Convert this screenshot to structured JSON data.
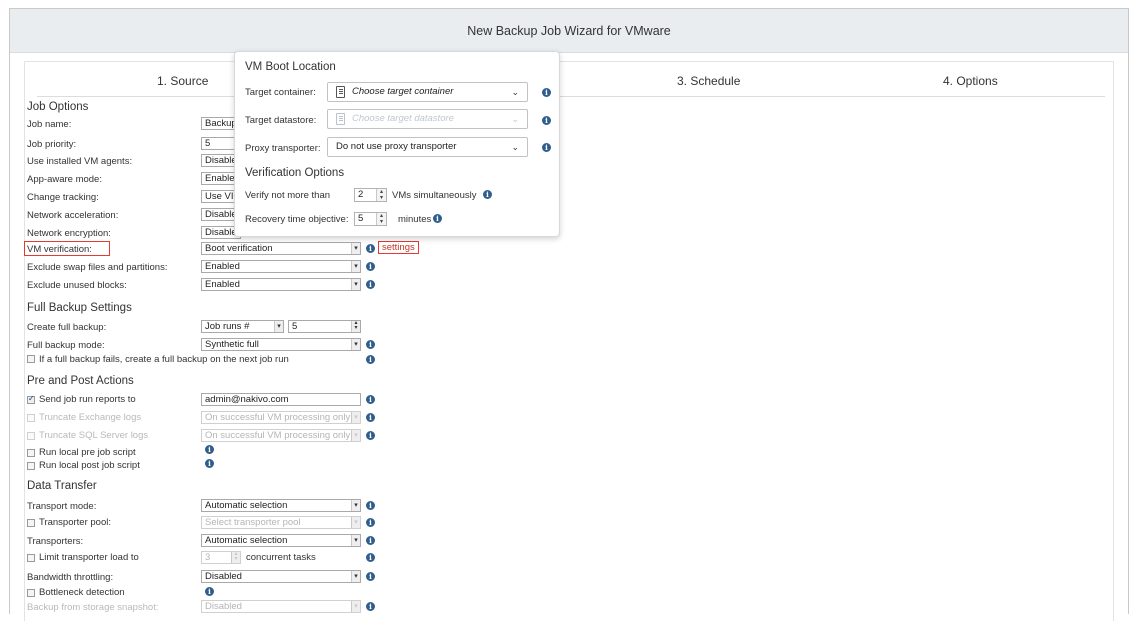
{
  "window": {
    "title": "New Backup Job Wizard for VMware"
  },
  "steps": [
    "1. Source",
    "3. Schedule",
    "4. Options"
  ],
  "sections": {
    "job_options": "Job Options",
    "full_backup": "Full Backup Settings",
    "pre_post": "Pre and Post Actions",
    "data_transfer": "Data Transfer"
  },
  "job_options": {
    "job_name": {
      "label": "Job name:",
      "value": "Backup"
    },
    "job_priority": {
      "label": "Job priority:",
      "value": "5"
    },
    "vm_agents": {
      "label": "Use installed VM agents:",
      "value": "Disable"
    },
    "app_aware": {
      "label": "App-aware mode:",
      "value": "Enable"
    },
    "change_tracking": {
      "label": "Change tracking:",
      "value": "Use VI"
    },
    "net_accel": {
      "label": "Network acceleration:",
      "value": "Disable"
    },
    "net_encrypt": {
      "label": "Network encryption:",
      "value": "Disable"
    },
    "vm_verification": {
      "label": "VM verification:",
      "value": "Boot verification",
      "settings_link": "settings"
    },
    "exclude_swap": {
      "label": "Exclude swap files and partitions:",
      "value": "Enabled"
    },
    "exclude_unused": {
      "label": "Exclude unused blocks:",
      "value": "Enabled"
    }
  },
  "full_backup": {
    "create": {
      "label": "Create full backup:",
      "value": "Job runs #",
      "number": "5"
    },
    "mode": {
      "label": "Full backup mode:",
      "value": "Synthetic full"
    },
    "fail_checkbox": {
      "label": "If a full backup fails, create a full backup on the next job run",
      "checked": false
    }
  },
  "pre_post": {
    "send_reports": {
      "label": "Send job run reports to",
      "checked": true,
      "value": "admin@nakivo.com"
    },
    "truncate_exchange": {
      "label": "Truncate Exchange logs",
      "checked": false,
      "value": "On successful VM processing only"
    },
    "truncate_sql": {
      "label": "Truncate SQL Server logs",
      "checked": false,
      "value": "On successful VM processing only"
    },
    "pre_script": {
      "label": "Run local pre job script",
      "checked": false
    },
    "post_script": {
      "label": "Run local post job script",
      "checked": false
    }
  },
  "data_transfer": {
    "transport_mode": {
      "label": "Transport mode:",
      "value": "Automatic selection"
    },
    "transporter_pool": {
      "label": "Transporter pool:",
      "checked": false,
      "placeholder": "Select transporter pool"
    },
    "transporters": {
      "label": "Transporters:",
      "value": "Automatic selection"
    },
    "limit_load": {
      "label": "Limit transporter load to",
      "checked": false,
      "value": "3",
      "suffix": "concurrent tasks"
    },
    "bandwidth": {
      "label": "Bandwidth throttling:",
      "value": "Disabled"
    },
    "bottleneck": {
      "label": "Bottleneck detection",
      "checked": false
    },
    "storage_snapshot": {
      "label": "Backup from storage snapshot:",
      "value": "Disabled"
    }
  },
  "popup": {
    "boot_location_title": "VM Boot Location",
    "target_container": {
      "label": "Target container:",
      "placeholder": "Choose target container"
    },
    "target_datastore": {
      "label": "Target datastore:",
      "placeholder": "Choose target datastore"
    },
    "proxy_transporter": {
      "label": "Proxy transporter:",
      "value": "Do not use proxy transporter"
    },
    "verification_title": "Verification Options",
    "verify_prefix": "Verify not more than",
    "verify_value": "2",
    "verify_suffix": "VMs simultaneously",
    "rto_label": "Recovery time objective:",
    "rto_value": "5",
    "rto_suffix": "minutes"
  },
  "icons": {
    "info": "info-icon",
    "dropdown": "chevron-down-icon",
    "spinner": "spinner-arrows-icon",
    "container": "document-icon"
  },
  "colors": {
    "highlight_red": "#e53935",
    "info_blue": "#2f5e8d",
    "title_bar": "#e9edf0"
  }
}
